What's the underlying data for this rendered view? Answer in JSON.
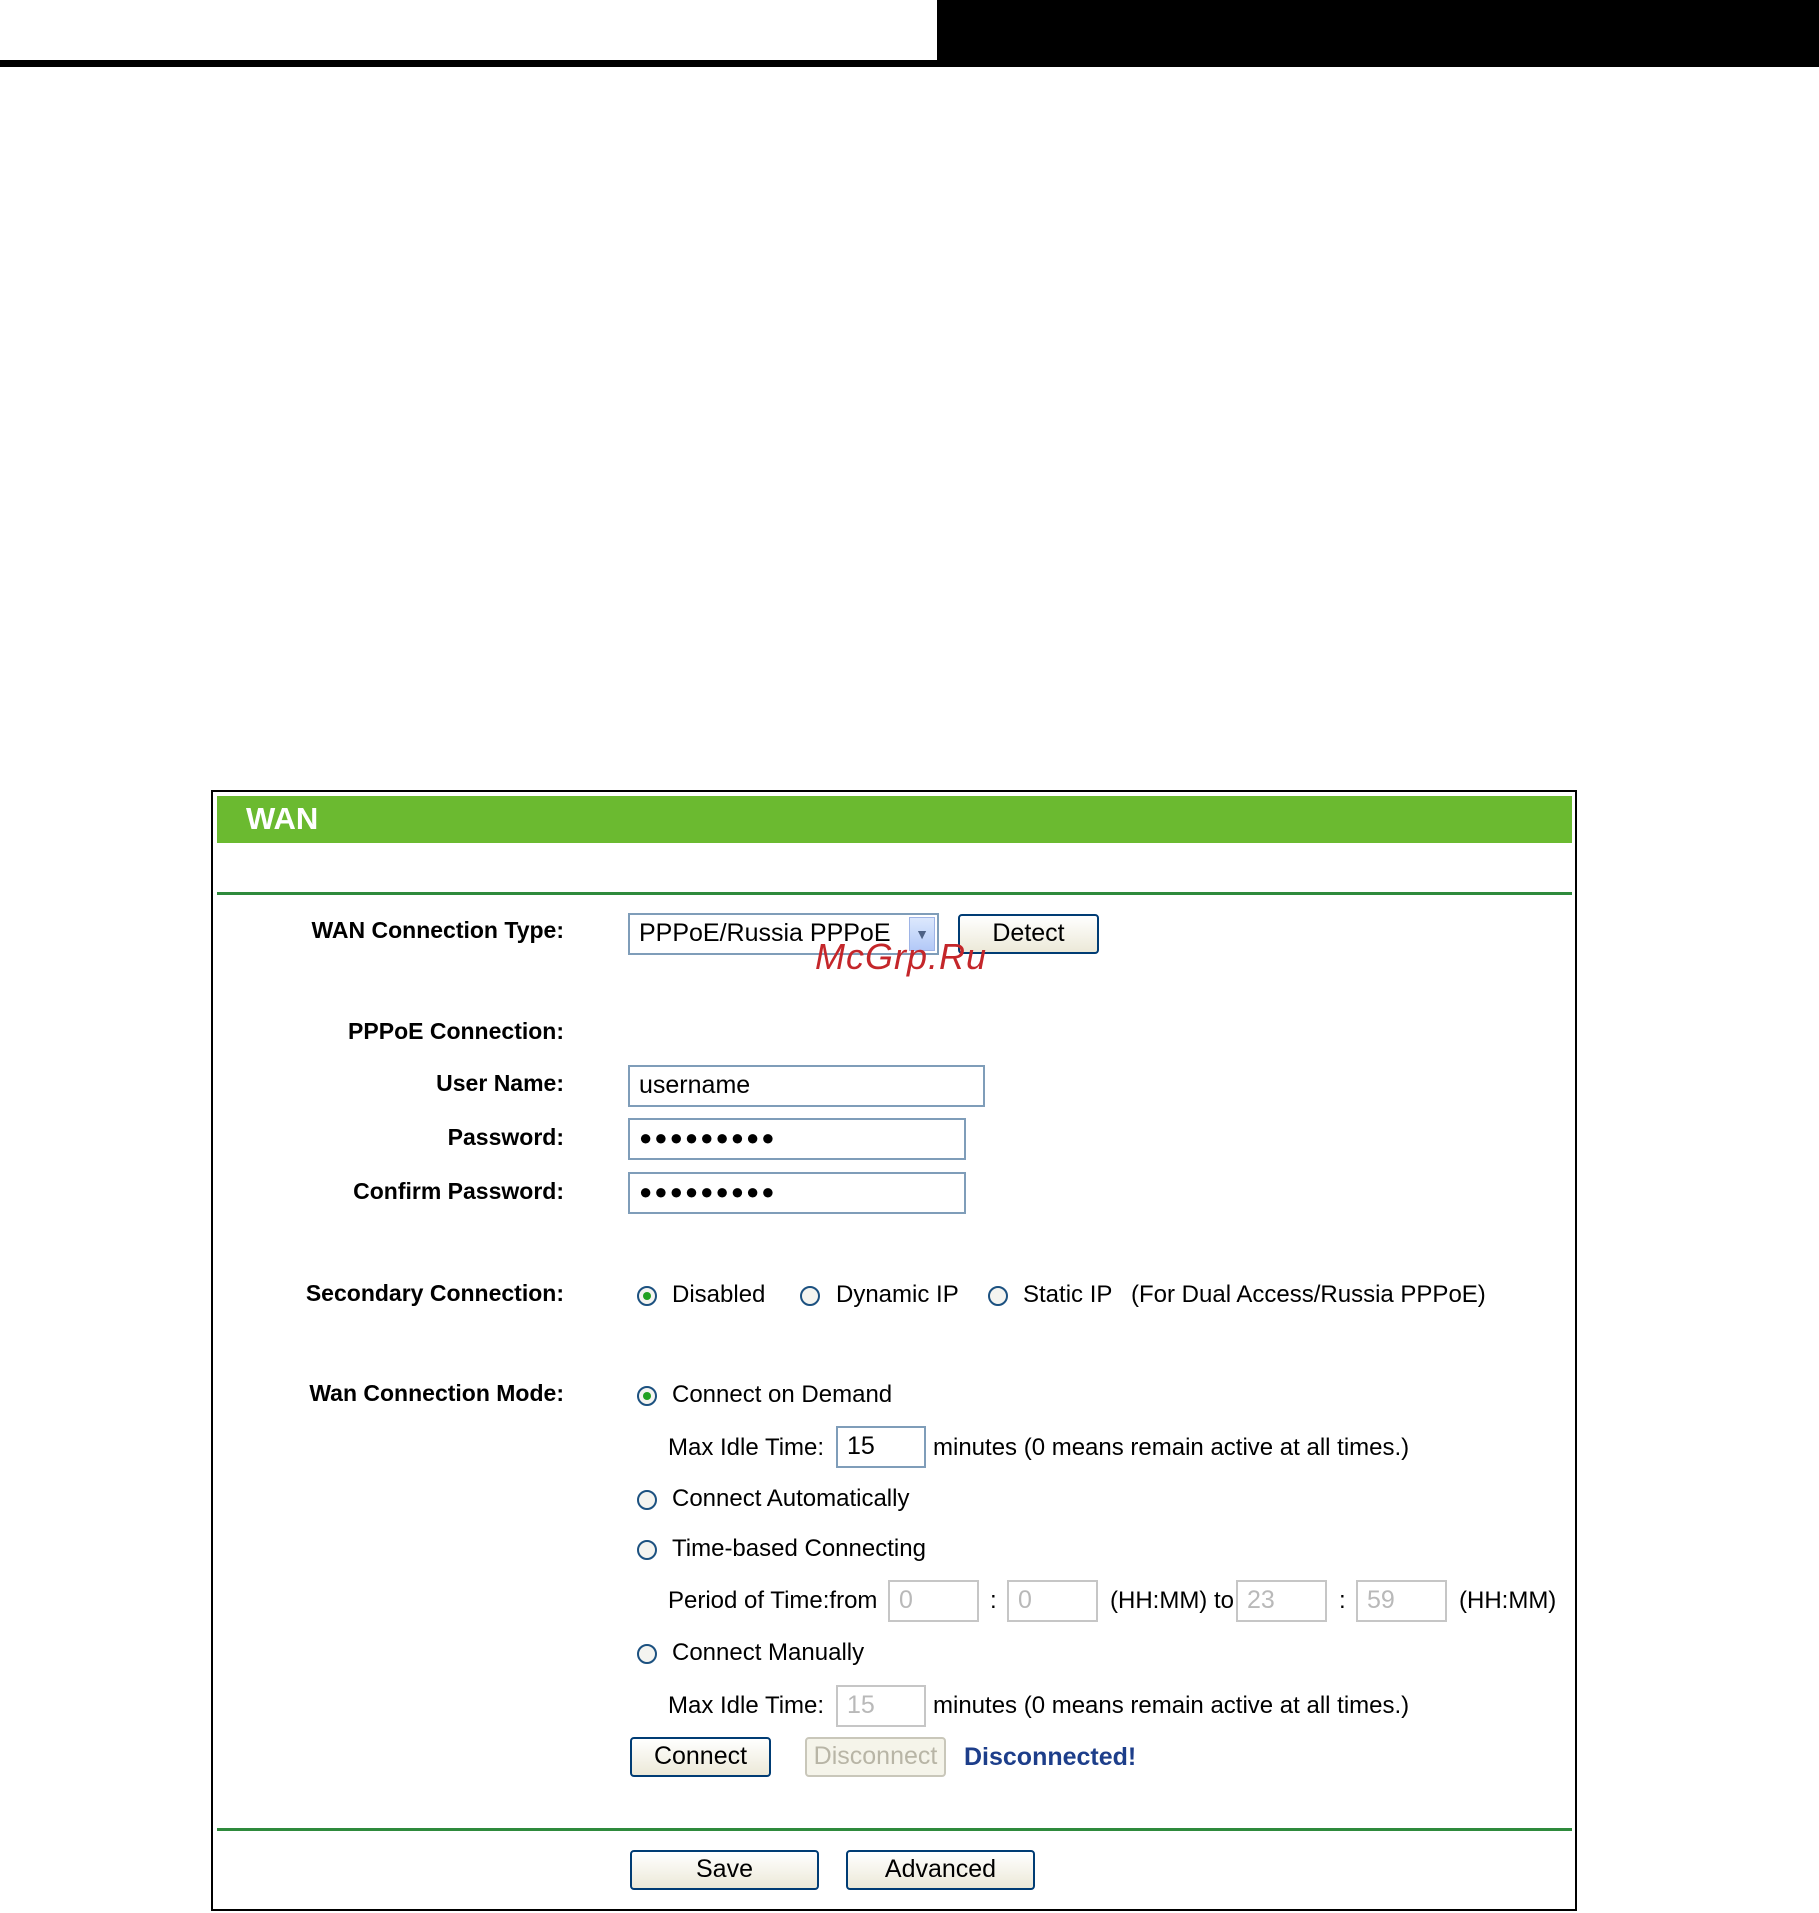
{
  "page": {
    "title": "WAN",
    "watermark": "McGrp.Ru"
  },
  "wan_connection_type": {
    "label": "WAN Connection Type:",
    "selected": "PPPoE/Russia PPPoE",
    "detect_button": "Detect"
  },
  "pppoe": {
    "section_label": "PPPoE Connection:",
    "user_name_label": "User Name:",
    "user_name_value": "username",
    "password_label": "Password:",
    "password_value": "●●●●●●●●●",
    "confirm_password_label": "Confirm Password:",
    "confirm_password_value": "●●●●●●●●●"
  },
  "secondary_connection": {
    "label": "Secondary Connection:",
    "options": [
      "Disabled",
      "Dynamic IP",
      "Static IP"
    ],
    "selected": "Disabled",
    "note": "(For Dual Access/Russia PPPoE)"
  },
  "connection_mode": {
    "label": "Wan Connection Mode:",
    "selected": "Connect on Demand",
    "on_demand": {
      "label": "Connect on Demand",
      "idle_label": "Max Idle Time:",
      "idle_value": "15",
      "idle_note": "minutes (0 means remain active at all times.)"
    },
    "automatic": {
      "label": "Connect Automatically"
    },
    "time_based": {
      "label": "Time-based Connecting",
      "period_label": "Period of Time:from",
      "from_hh": "0",
      "from_mm": "0",
      "sep": ":",
      "to_label": "(HH:MM) to",
      "to_hh": "23",
      "to_mm": "59",
      "end_label": "(HH:MM)"
    },
    "manual": {
      "label": "Connect Manually",
      "idle_label": "Max Idle Time:",
      "idle_value": "15",
      "idle_note": "minutes (0 means remain active at all times.)"
    },
    "connect_button": "Connect",
    "disconnect_button": "Disconnect",
    "status": "Disconnected!"
  },
  "footer": {
    "save_button": "Save",
    "advanced_button": "Advanced"
  }
}
